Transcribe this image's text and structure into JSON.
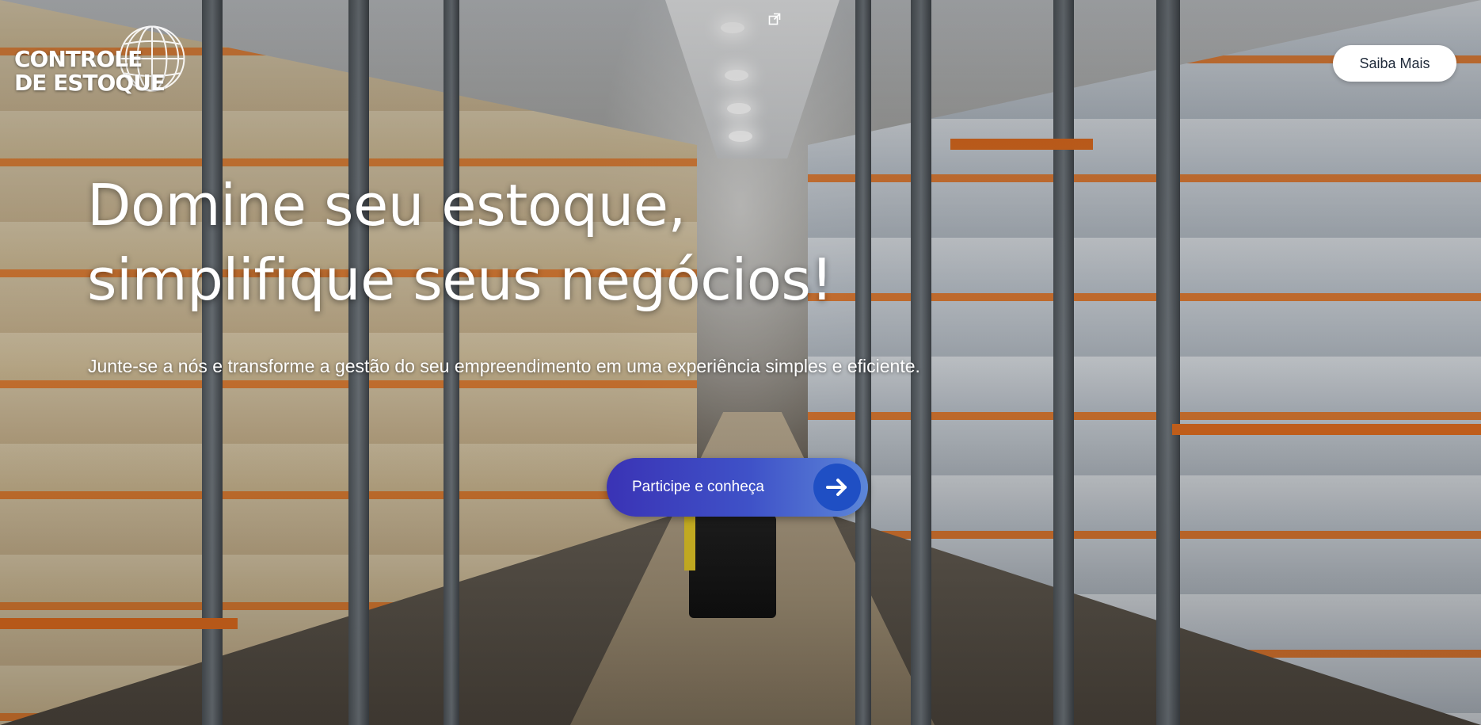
{
  "brand": {
    "logo_line1": "CONTROLE",
    "logo_line2": "DE ESTOQUE",
    "logo_icon": "globe-icon"
  },
  "header": {
    "cta_label": "Saiba Mais"
  },
  "hero": {
    "title_line1": "Domine seu estoque,",
    "title_line2": "simplifique seus negócios!",
    "subtitle": "Junte-se a nós e transforme a gestão do seu empreendimento em uma experiência simples e eficiente.",
    "cta_label": "Participe e conheça",
    "cta_icon": "arrow-right-icon"
  },
  "video": {
    "popout_icon": "popout-icon"
  },
  "colors": {
    "cta_start": "#3a33b5",
    "cta_end": "#5c86d8",
    "cta_circle": "#1f4fc4",
    "text": "#ffffff"
  }
}
